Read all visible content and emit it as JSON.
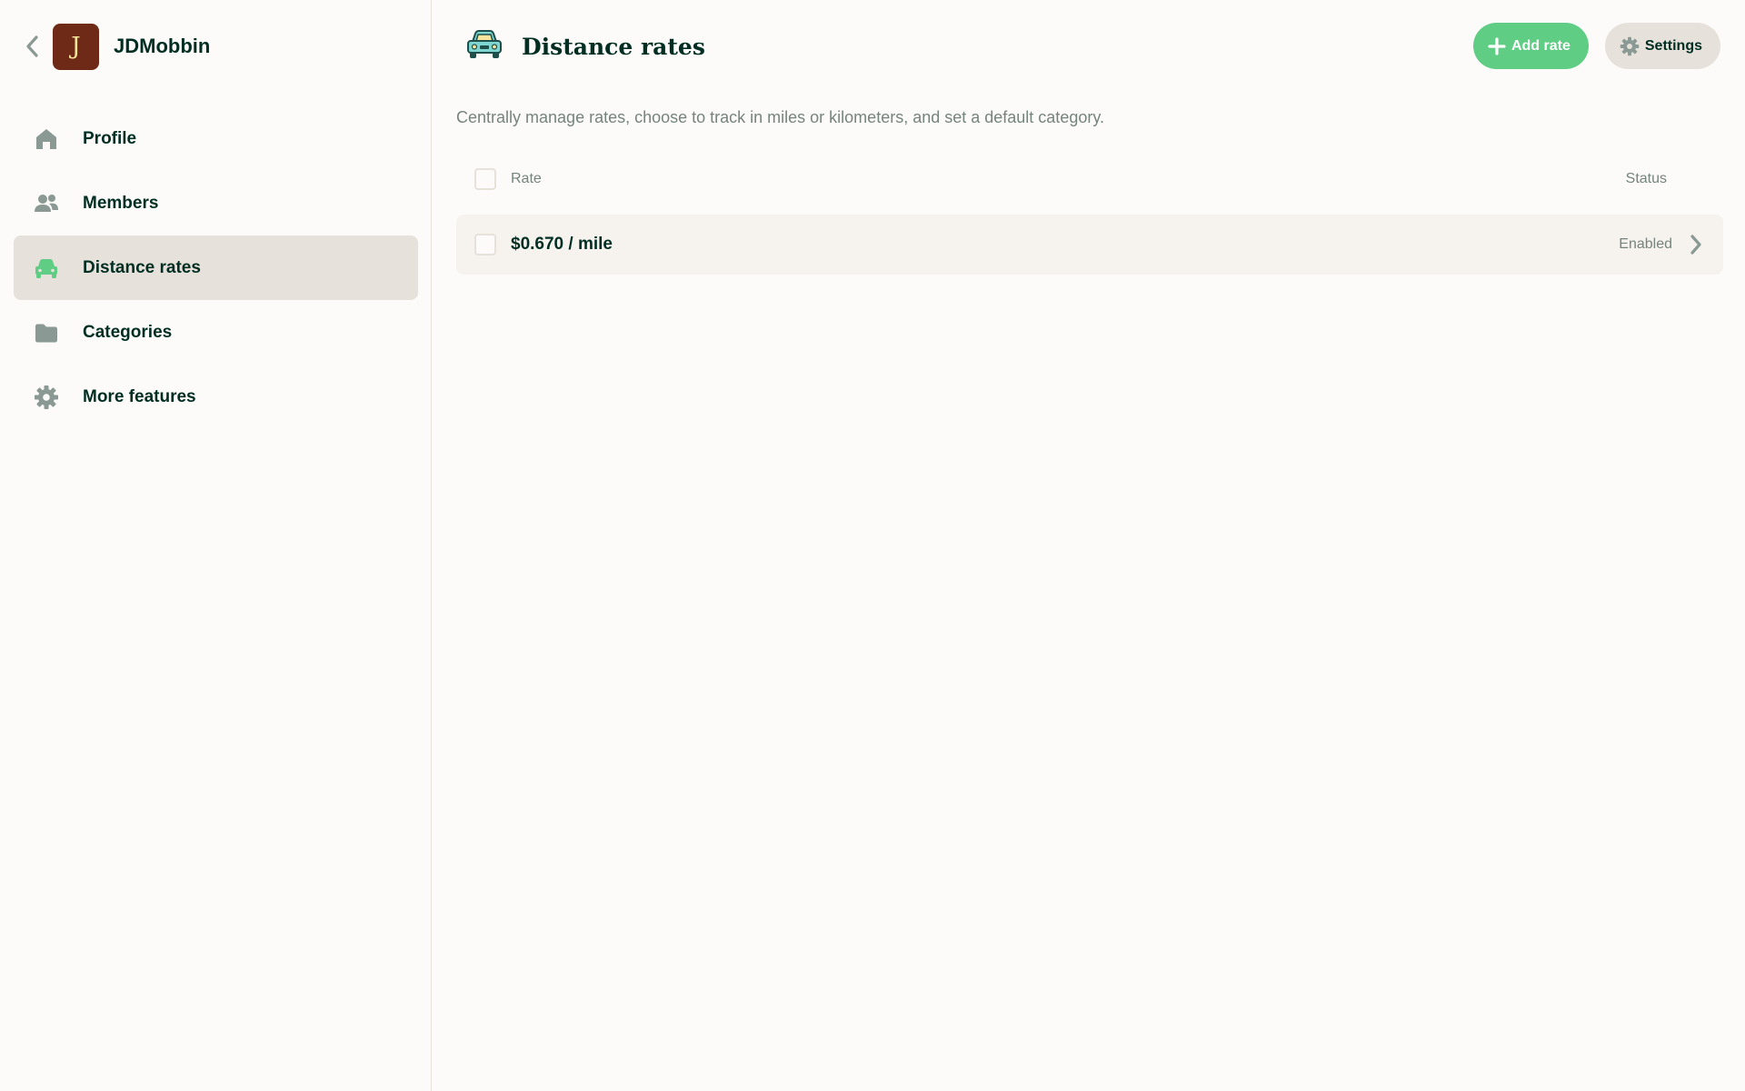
{
  "workspace": {
    "avatar_letter": "J",
    "name": "JDMobbin"
  },
  "sidebar": {
    "items": [
      {
        "label": "Profile",
        "icon": "home-icon"
      },
      {
        "label": "Members",
        "icon": "users-icon"
      },
      {
        "label": "Distance rates",
        "icon": "car-icon",
        "active": true
      },
      {
        "label": "Categories",
        "icon": "folder-icon"
      },
      {
        "label": "More features",
        "icon": "gear-icon"
      }
    ]
  },
  "header": {
    "title": "Distance rates",
    "add_label": "Add rate",
    "settings_label": "Settings"
  },
  "description": "Centrally manage rates, choose to track in miles or kilometers, and set a default category.",
  "table": {
    "columns": {
      "rate": "Rate",
      "status": "Status"
    },
    "rows": [
      {
        "rate": "$0.670 / mile",
        "status": "Enabled"
      }
    ]
  },
  "colors": {
    "accent": "#5fcd84",
    "text": "#002e22",
    "muted": "#76847e",
    "active_bg": "#e6e1da",
    "avatar_bg": "#6f2a17"
  }
}
